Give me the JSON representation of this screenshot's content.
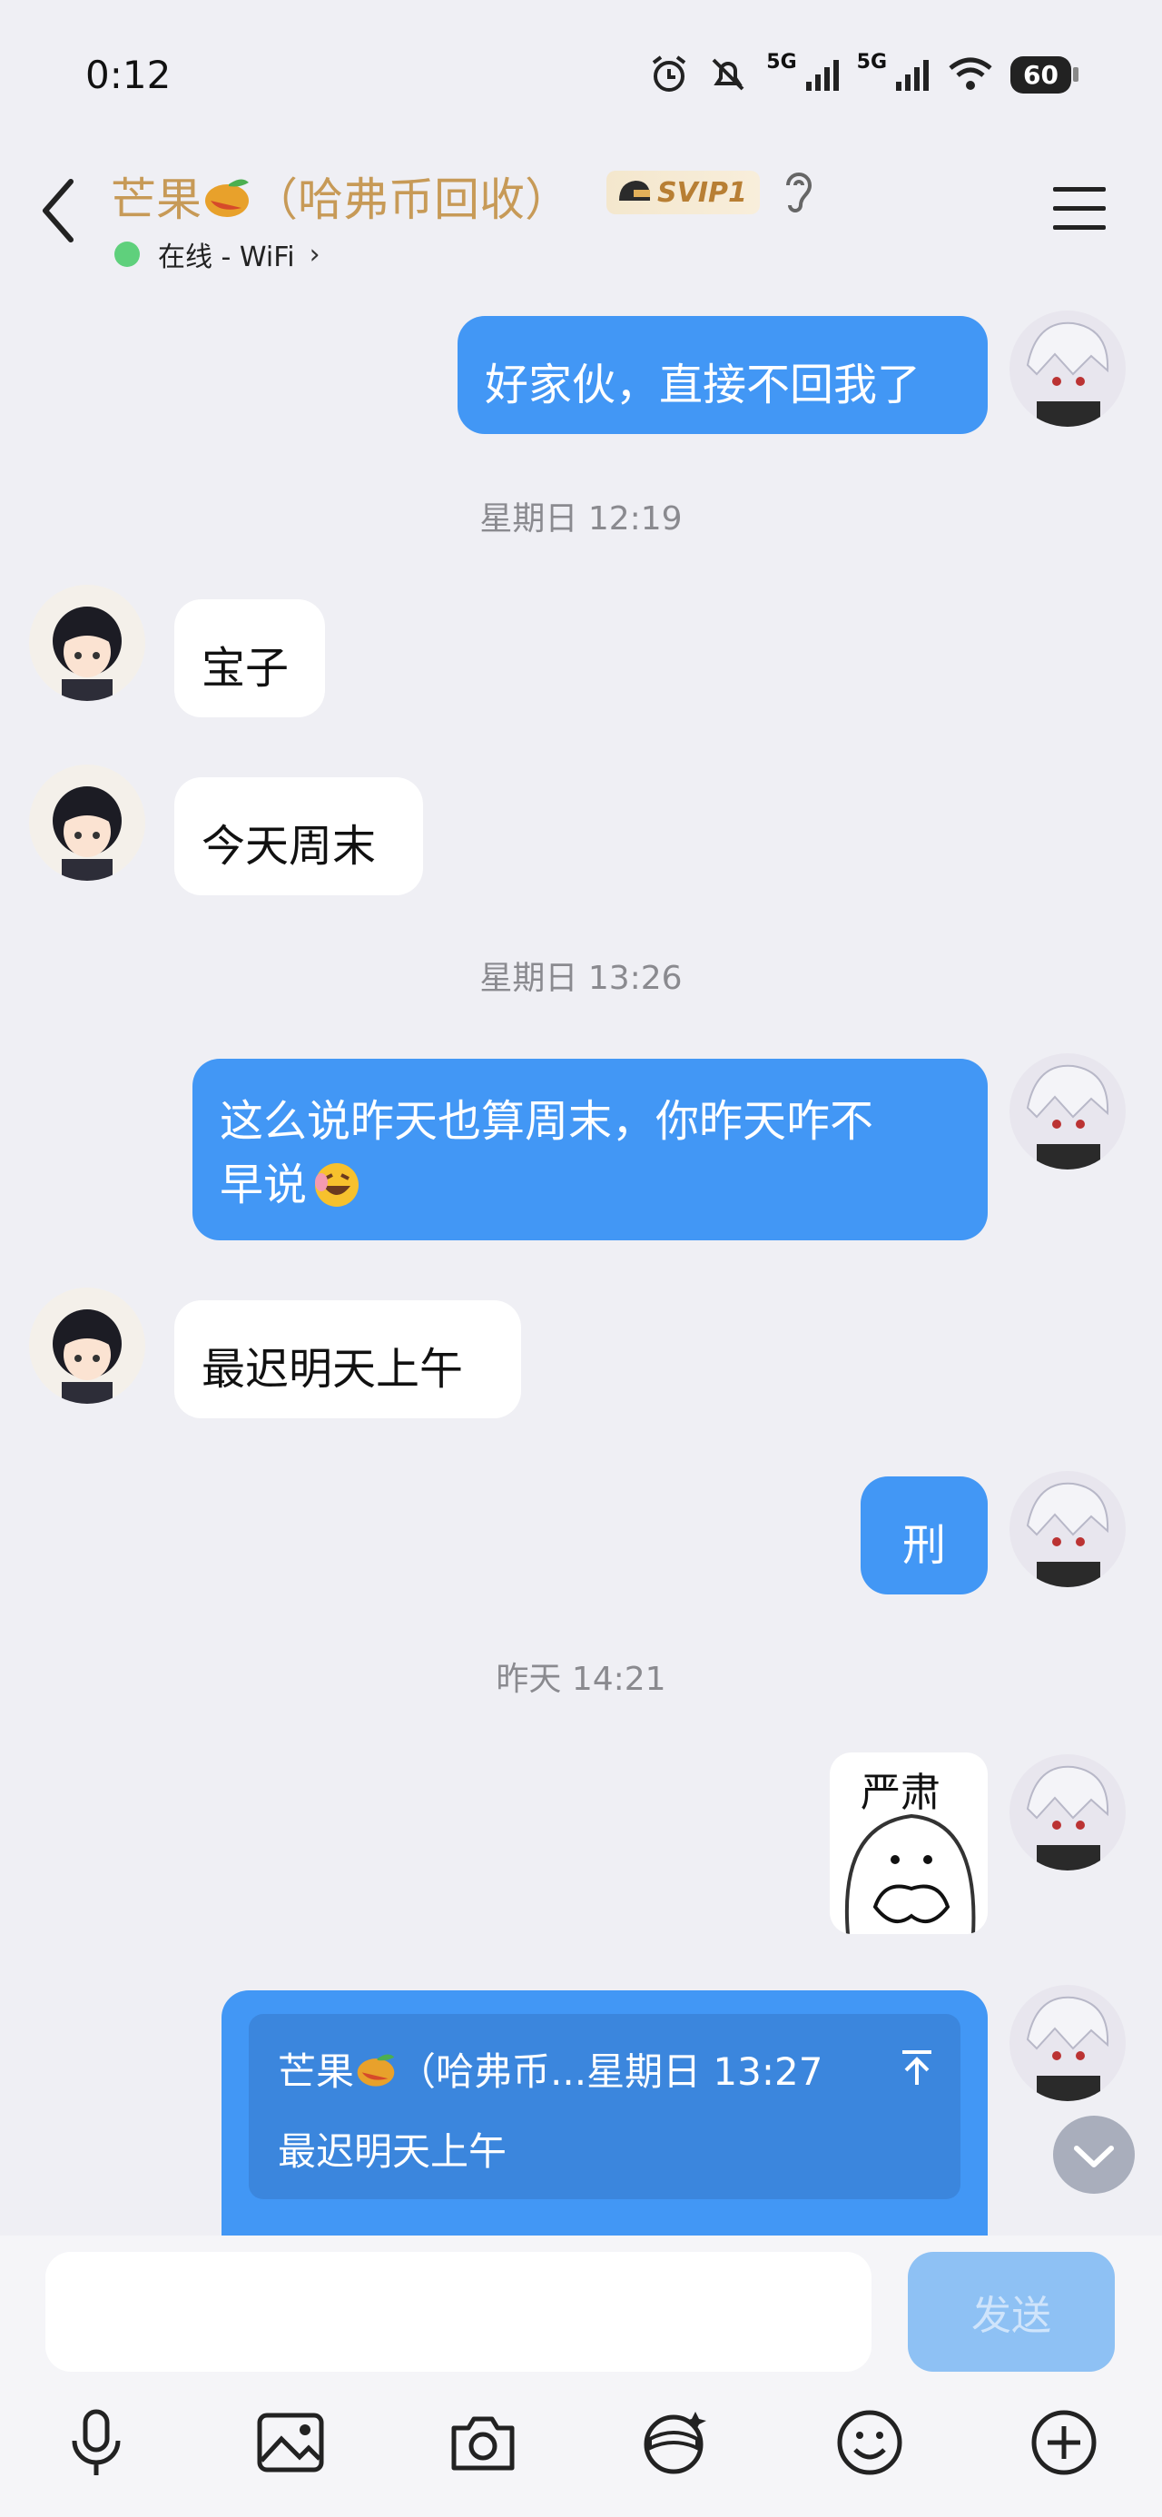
{
  "status_bar": {
    "time": "0:12",
    "network_5g_1": "5G",
    "network_5g_2": "5G",
    "battery": "60"
  },
  "header": {
    "title_prefix": "芒果",
    "title_suffix": "（哈弗币回收）",
    "svip_badge": "SVIP1",
    "status_text": "在线 - WiFi"
  },
  "messages": {
    "m1_text": "好家伙，直接不回我了",
    "ts1": "星期日 12:19",
    "m2_text": "宝子",
    "m3_text": "今天周末",
    "ts2": "星期日 13:26",
    "m4_line1": "这么说昨天也算周末，你昨天咋不",
    "m4_line2": "早说",
    "m5_text": "最迟明天上午",
    "m6_text": "刑",
    "ts3": "昨天 14:21",
    "sticker_text": "严肃",
    "quote_sender_prefix": "芒果",
    "quote_sender_suffix": "（哈弗币...",
    "quote_time": "星期日 13:27",
    "quote_text": "最迟明天上午"
  },
  "composer": {
    "send_label": "发送",
    "input_value": ""
  },
  "toolbar": [
    "microphone-icon",
    "image-icon",
    "camera-icon",
    "face-filter-icon",
    "emoji-icon",
    "plus-icon"
  ],
  "colors": {
    "my_bubble": "#4297f5",
    "title_gold": "#c79a57",
    "online_green": "#5fd07c",
    "send_disabled": "#8ec1f4"
  }
}
